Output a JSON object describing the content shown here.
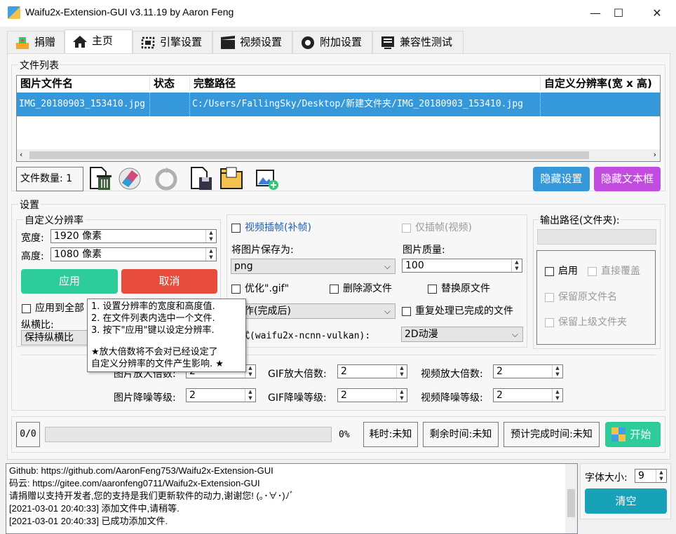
{
  "window": {
    "title": "Waifu2x-Extension-GUI v3.11.19 by Aaron Feng",
    "minimize": "—",
    "maximize": "☐",
    "close": "✕"
  },
  "tabs": [
    {
      "label": "捐赠",
      "icon": "donate-icon"
    },
    {
      "label": "主页",
      "icon": "home-icon"
    },
    {
      "label": "引擎设置",
      "icon": "engine-icon"
    },
    {
      "label": "视频设置",
      "icon": "video-icon"
    },
    {
      "label": "附加设置",
      "icon": "addon-icon"
    },
    {
      "label": "兼容性测试",
      "icon": "compat-icon"
    }
  ],
  "file_list": {
    "title": "文件列表",
    "columns": [
      "图片文件名",
      "状态",
      "完整路径",
      "自定义分辨率(宽 x 高)"
    ],
    "rows": [
      {
        "name": "IMG_20180903_153410.jpg",
        "status": "",
        "path": "C:/Users/FallingSky/Desktop/新建文件夹/IMG_20180903_153410.jpg",
        "custom_res": ""
      }
    ]
  },
  "toolbar": {
    "file_count": "文件数量: 1",
    "hide_settings": "隐藏设置",
    "hide_textbox": "隐藏文本框"
  },
  "settings": {
    "title": "设置",
    "custom_res": {
      "title": "自定义分辨率",
      "width_label": "宽度:",
      "width_value": "1920 像素",
      "height_label": "高度:",
      "height_value": "1080 像素",
      "apply": "应用",
      "cancel": "取消",
      "apply_all": "应用到全部",
      "ratio_label": "纵横比:",
      "ratio_value": "保持纵横比"
    },
    "video_interp": "视频插帧(补帧)",
    "interp_only": "仅插帧(视频)",
    "save_as_label": "将图片保存为:",
    "save_as_value": "png",
    "quality_label": "图片质量:",
    "quality_value": "100",
    "optimize_gif": "优化\".gif\"",
    "delete_source": "删除源文件",
    "replace_source": "替换原文件",
    "action_value": "动作(完成后)",
    "reprocess": "重复处理已完成的文件",
    "style_label": "样式(waifu2x-ncnn-vulkan):",
    "style_value": "2D动漫",
    "output": {
      "title": "输出路径(文件夹):",
      "enable": "启用",
      "overwrite": "直接覆盖",
      "keep_name": "保留原文件名",
      "keep_parent": "保留上级文件夹"
    },
    "scale": {
      "img_scale_label": "图片放大倍数:",
      "img_scale": "2",
      "gif_scale_label": "GIF放大倍数:",
      "gif_scale": "2",
      "vid_scale_label": "视频放大倍数:",
      "vid_scale": "2",
      "img_noise_label": "图片降噪等级:",
      "img_noise": "2",
      "gif_noise_label": "GIF降噪等级:",
      "gif_noise": "2",
      "vid_noise_label": "视频降噪等级:",
      "vid_noise": "2"
    }
  },
  "tooltip": {
    "l1": "1. 设置分辨率的宽度和高度值.",
    "l2": "2. 在文件列表内选中一个文件.",
    "l3": "3. 按下\"应用\"键以设定分辨率.",
    "l4": "★放大倍数将不会对已经设定了",
    "l5": "自定义分辨率的文件产生影响. ★"
  },
  "progress": {
    "count": "0/0",
    "percent": "0%",
    "fraction": 0,
    "elapsed": "耗时:未知",
    "remaining": "剩余时间:未知",
    "eta": "预计完成时间:未知",
    "start": "开始"
  },
  "log": [
    "Github: https://github.com/AaronFeng753/Waifu2x-Extension-GUI",
    "码云: https://gitee.com/aaronfeng0711/Waifu2x-Extension-GUI",
    "请捐赠以支持开发者,您的支持是我们更新软件的动力,谢谢您! (｡･∀･)ﾉﾞ",
    "[2021-03-01 20:40:33] 添加文件中,请稍等.",
    "[2021-03-01 20:40:33] 已成功添加文件."
  ],
  "font": {
    "label": "字体大小:",
    "value": "9",
    "clear": "清空"
  },
  "colors": {
    "accent": "#3498db",
    "green": "#2ecc9a",
    "red": "#e74c3c",
    "purple": "#c44be0"
  }
}
